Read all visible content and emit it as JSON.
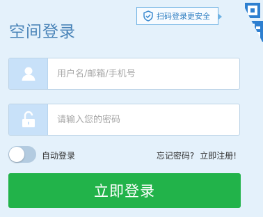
{
  "title": "空间登录",
  "qr_tip": {
    "label": "扫码登录更安全"
  },
  "username": {
    "placeholder": "用户名/邮箱/手机号",
    "value": ""
  },
  "password": {
    "placeholder": "请输入您的密码",
    "value": ""
  },
  "auto_login": {
    "label": "自动登录",
    "enabled": false
  },
  "links": {
    "forgot": "忘记密码?",
    "register": "立即注册!"
  },
  "login_button": {
    "label": "立即登录"
  },
  "colors": {
    "accent": "#22b34a",
    "title": "#4a84b8",
    "background": "#e4f1fb",
    "icon_box": "#c8e1f9"
  }
}
